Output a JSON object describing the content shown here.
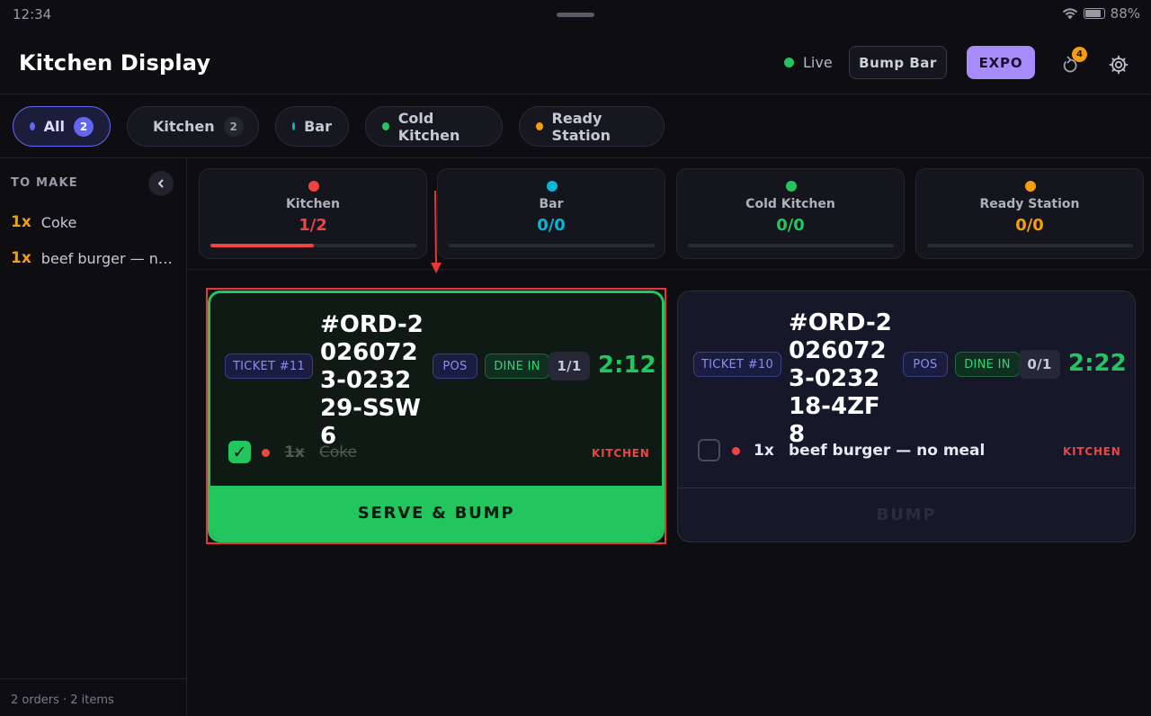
{
  "status_bar": {
    "time": "12:34",
    "battery": "88%"
  },
  "header": {
    "title": "Kitchen Display",
    "live_label": "Live",
    "bump_bar_label": "Bump Bar",
    "expo_label": "EXPO",
    "undo_badge": "4"
  },
  "colors": {
    "kitchen": "#ef4444",
    "bar": "#06b6d4",
    "cold_kitchen": "#22c55e",
    "ready_station": "#f59e0b",
    "accent": "#6366f1",
    "expo": "#a78bfa"
  },
  "tabs": [
    {
      "label": "All",
      "count": "2",
      "active": true
    },
    {
      "label": "Kitchen",
      "count": "2"
    },
    {
      "label": "Bar"
    },
    {
      "label": "Cold Kitchen"
    },
    {
      "label": "Ready Station"
    }
  ],
  "sidebar": {
    "heading": "TO MAKE",
    "items": [
      {
        "qty": "1x",
        "name": "Coke"
      },
      {
        "qty": "1x",
        "name": "beef burger — no meal"
      }
    ],
    "footer": "2 orders · 2 items"
  },
  "stations": [
    {
      "name": "Kitchen",
      "value": "1/2",
      "progress": 0.5
    },
    {
      "name": "Bar",
      "value": "0/0",
      "progress": 0
    },
    {
      "name": "Cold Kitchen",
      "value": "0/0",
      "progress": 0
    },
    {
      "name": "Ready Station",
      "value": "0/0",
      "progress": 0
    }
  ],
  "orders": [
    {
      "ticket": "TICKET #11",
      "order_number": "#ORD-20260723-023229-SSW6",
      "source": "POS",
      "type": "DINE IN",
      "progress": "1/1",
      "timer": "2:12",
      "item": {
        "qty": "1x",
        "name": "Coke",
        "station": "KITCHEN",
        "done": true
      },
      "action": "SERVE & BUMP"
    },
    {
      "ticket": "TICKET #10",
      "order_number": "#ORD-20260723-023218-4ZF8",
      "source": "POS",
      "type": "DINE IN",
      "progress": "0/1",
      "timer": "2:22",
      "item": {
        "qty": "1x",
        "name": "beef burger — no meal",
        "station": "KITCHEN",
        "done": false
      },
      "action": "BUMP"
    }
  ]
}
